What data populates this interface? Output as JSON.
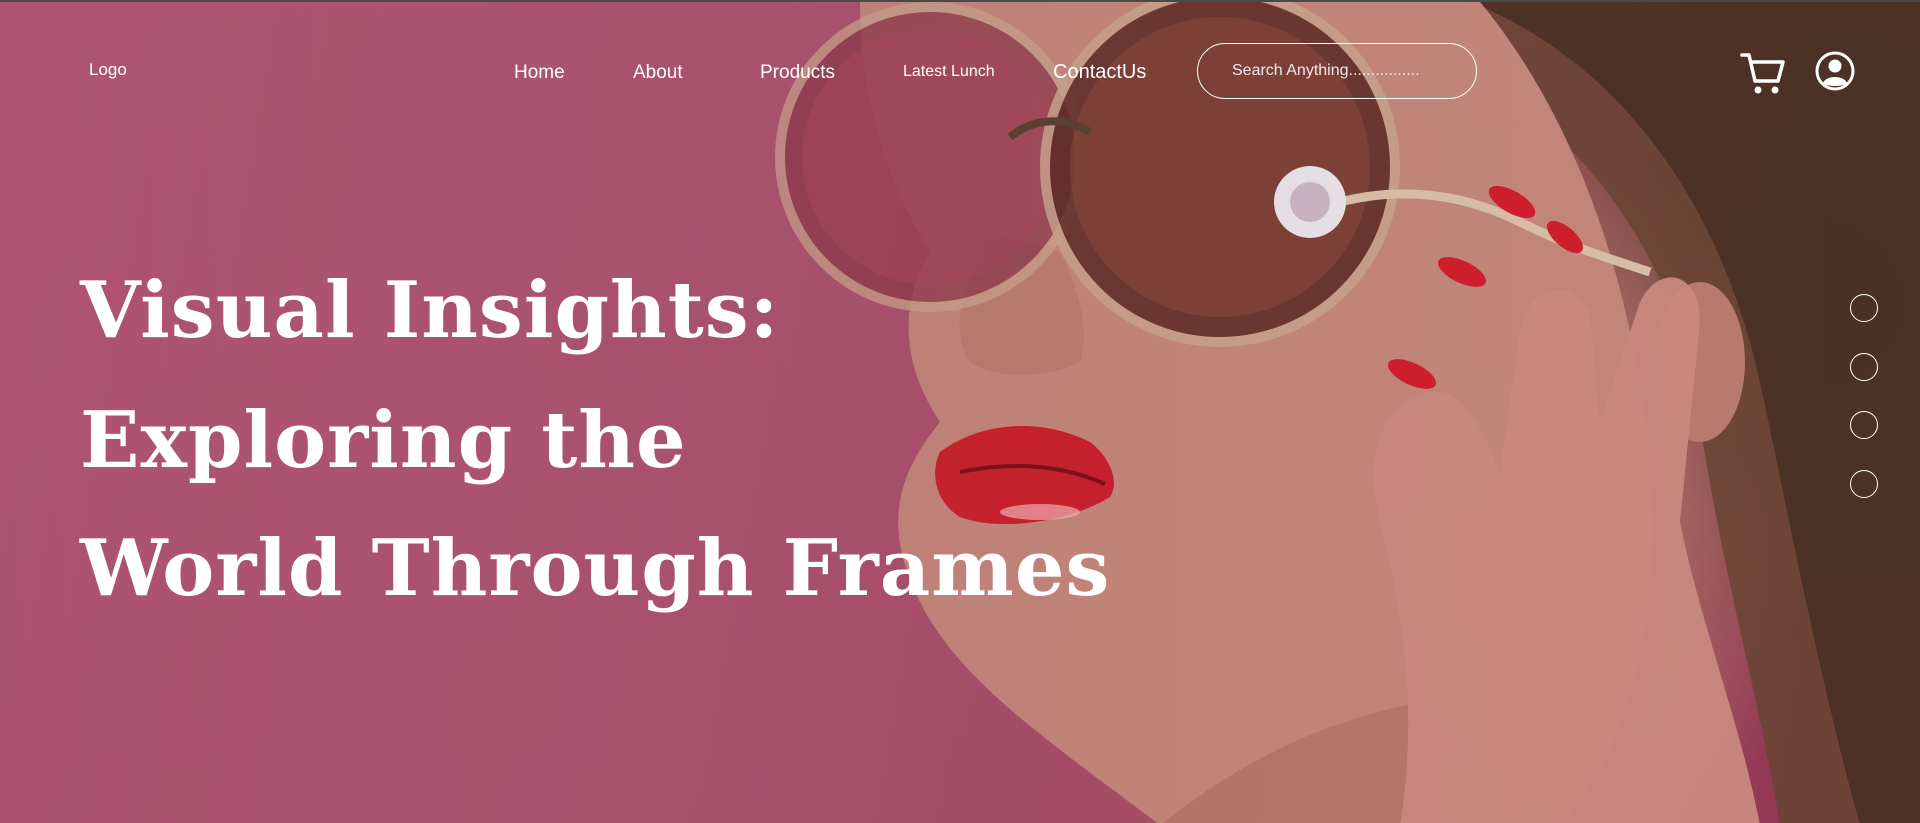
{
  "header": {
    "logo": "Logo",
    "nav": {
      "home": "Home",
      "about": "About",
      "products": "Products",
      "latest_lunch": "Latest Lunch",
      "contact": "ContactUs"
    },
    "search": {
      "placeholder": "Search Anything................",
      "value": ""
    },
    "icons": {
      "cart": "cart-icon",
      "account": "user-circle-icon"
    }
  },
  "hero": {
    "headline_lines": [
      "Visual Insights:",
      "Exploring the",
      "World Through Frames"
    ],
    "image": "woman-wearing-round-sunglasses-photo"
  },
  "carousel": {
    "dots": 4,
    "dot_style": "outline-circle"
  },
  "colors": {
    "background": "#a9546f",
    "text": "#ffffff",
    "lips": "#c8202a"
  }
}
